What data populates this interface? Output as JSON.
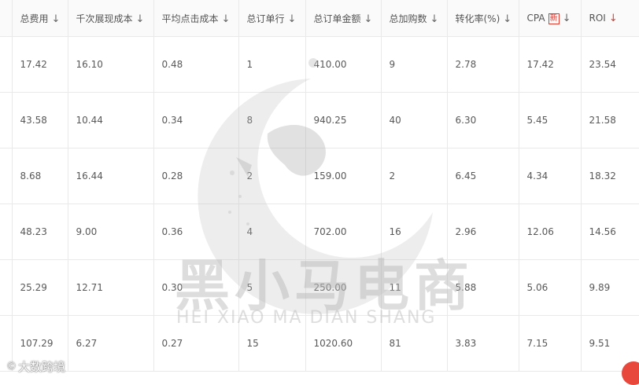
{
  "table": {
    "columns": [
      {
        "label": "",
        "arrow": ""
      },
      {
        "label": "总费用",
        "arrow": "↓"
      },
      {
        "label": "千次展现成本",
        "arrow": "↓"
      },
      {
        "label": "平均点击成本",
        "arrow": "↓"
      },
      {
        "label": "总订单行",
        "arrow": "↓"
      },
      {
        "label": "总订单金额",
        "arrow": "↓"
      },
      {
        "label": "总加购数",
        "arrow": "↓"
      },
      {
        "label": "转化率(%)",
        "arrow": "↓"
      },
      {
        "label": "CPA",
        "badge": "新",
        "arrow": "↓"
      },
      {
        "label": "ROI",
        "arrow": "↓"
      }
    ],
    "rows": [
      [
        "",
        "17.42",
        "16.10",
        "0.48",
        "1",
        "410.00",
        "9",
        "2.78",
        "17.42",
        "23.54"
      ],
      [
        "",
        "43.58",
        "10.44",
        "0.34",
        "8",
        "940.25",
        "40",
        "6.30",
        "5.45",
        "21.58"
      ],
      [
        "",
        "8.68",
        "16.44",
        "0.28",
        "2",
        "159.00",
        "2",
        "6.45",
        "4.34",
        "18.32"
      ],
      [
        "",
        "48.23",
        "9.00",
        "0.36",
        "4",
        "702.00",
        "16",
        "2.96",
        "12.06",
        "14.56"
      ],
      [
        "",
        "25.29",
        "12.71",
        "0.30",
        "5",
        "250.00",
        "11",
        "5.88",
        "5.06",
        "9.89"
      ],
      [
        "",
        "107.29",
        "6.27",
        "0.27",
        "15",
        "1020.60",
        "81",
        "3.83",
        "7.15",
        "9.51"
      ]
    ]
  },
  "watermark": {
    "cn": "黑小马电商",
    "en": "HEI XIAO MA DIAN SHANG"
  },
  "corner_brand": {
    "logo": "©",
    "text": "大数跨境"
  },
  "colors": {
    "accent_red": "#e03a2f",
    "border": "#e9e9e9",
    "header_bg": "#fafafa"
  }
}
